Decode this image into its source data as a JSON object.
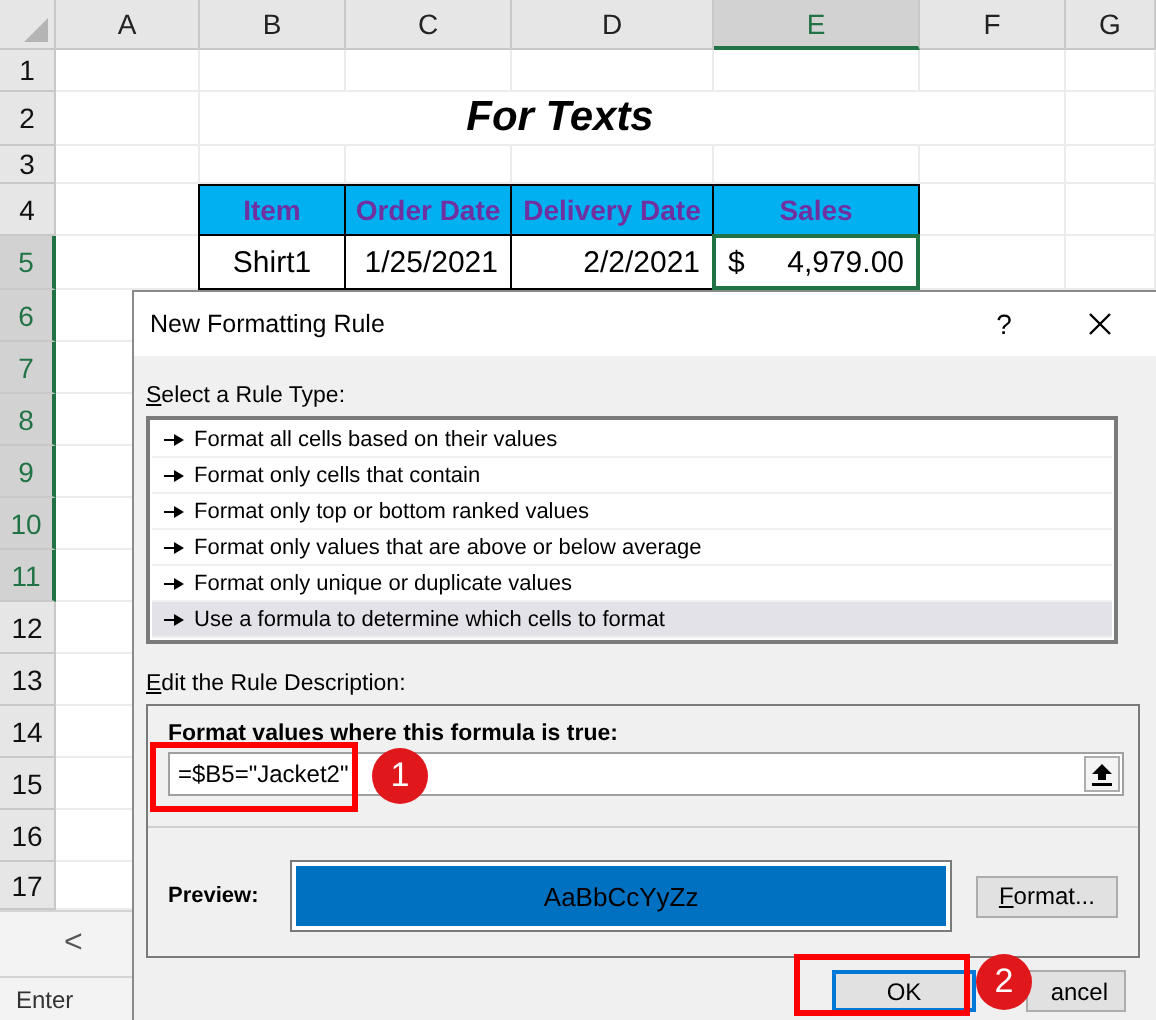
{
  "sheet": {
    "columns": [
      {
        "label": "A",
        "selected": false
      },
      {
        "label": "B",
        "selected": false
      },
      {
        "label": "C",
        "selected": false
      },
      {
        "label": "D",
        "selected": false
      },
      {
        "label": "E",
        "selected": true
      },
      {
        "label": "F",
        "selected": false
      },
      {
        "label": "G",
        "selected": false
      }
    ],
    "rows": [
      {
        "label": "1",
        "selected": false
      },
      {
        "label": "2",
        "selected": false
      },
      {
        "label": "3",
        "selected": false
      },
      {
        "label": "4",
        "selected": false
      },
      {
        "label": "5",
        "selected": true
      },
      {
        "label": "6",
        "selected": true
      },
      {
        "label": "7",
        "selected": true
      },
      {
        "label": "8",
        "selected": true
      },
      {
        "label": "9",
        "selected": true
      },
      {
        "label": "10",
        "selected": true
      },
      {
        "label": "11",
        "selected": true
      },
      {
        "label": "12",
        "selected": false
      },
      {
        "label": "13",
        "selected": false
      },
      {
        "label": "14",
        "selected": false
      },
      {
        "label": "15",
        "selected": false
      },
      {
        "label": "16",
        "selected": false
      },
      {
        "label": "17",
        "selected": false
      }
    ],
    "title": "For Texts",
    "table": {
      "columns": [
        "Item",
        "Order Date",
        "Delivery Date",
        "Sales"
      ],
      "rows": [
        {
          "item": "Shirt1",
          "order_date": "1/25/2021",
          "delivery_date": "2/2/2021",
          "currency": "$",
          "sales": "4,979.00"
        }
      ]
    },
    "sheet_nav": "<"
  },
  "dialog": {
    "title": "New Formatting Rule",
    "help": "?",
    "rule_type_label": "Select a Rule Type:",
    "rule_types": [
      {
        "label": "Format all cells based on their values",
        "selected": false
      },
      {
        "label": "Format only cells that contain",
        "selected": false
      },
      {
        "label": "Format only top or bottom ranked values",
        "selected": false
      },
      {
        "label": "Format only values that are above or below average",
        "selected": false
      },
      {
        "label": "Format only unique or duplicate values",
        "selected": false
      },
      {
        "label": "Use a formula to determine which cells to format",
        "selected": true
      }
    ],
    "description_label": "Edit the Rule Description:",
    "formula_label": "Format values where this formula is true:",
    "formula": "=$B5=\"Jacket2\"",
    "preview_label": "Preview:",
    "preview_sample": "AaBbCcYyZz",
    "format_button": "Format...",
    "ok_button": "OK",
    "cancel_button": "ancel"
  },
  "annotations": [
    {
      "number": "1"
    },
    {
      "number": "2"
    }
  ],
  "status_bar": {
    "mode": "Enter"
  }
}
